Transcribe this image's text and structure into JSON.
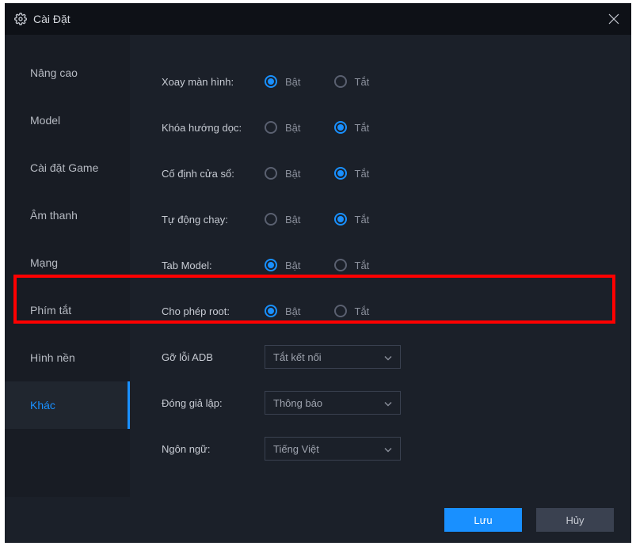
{
  "window": {
    "title": "Cài Đặt"
  },
  "sidebar": {
    "items": [
      {
        "label": "Nâng cao"
      },
      {
        "label": "Model"
      },
      {
        "label": "Cài đặt Game"
      },
      {
        "label": "Âm thanh"
      },
      {
        "label": "Mạng"
      },
      {
        "label": "Phím tắt"
      },
      {
        "label": "Hình nền"
      },
      {
        "label": "Khác"
      }
    ],
    "active_index": 7
  },
  "settings": {
    "radio_rows": [
      {
        "label": "Xoay màn hình:",
        "on": "Bật",
        "off": "Tắt",
        "selected": "on"
      },
      {
        "label": "Khóa hướng dọc:",
        "on": "Bật",
        "off": "Tắt",
        "selected": "off"
      },
      {
        "label": "Cố định cửa sổ:",
        "on": "Bật",
        "off": "Tắt",
        "selected": "off"
      },
      {
        "label": "Tự động chạy:",
        "on": "Bật",
        "off": "Tắt",
        "selected": "off"
      },
      {
        "label": "Tab Model:",
        "on": "Bật",
        "off": "Tắt",
        "selected": "on"
      },
      {
        "label": "Cho phép root:",
        "on": "Bật",
        "off": "Tắt",
        "selected": "on"
      }
    ],
    "dropdown_rows": [
      {
        "label": "Gỡ lỗi ADB",
        "value": "Tắt kết nối"
      },
      {
        "label": "Đóng giả lập:",
        "value": "Thông báo"
      },
      {
        "label": "Ngôn ngữ:",
        "value": "Tiếng Việt"
      }
    ]
  },
  "footer": {
    "save": "Lưu",
    "cancel": "Hủy"
  }
}
